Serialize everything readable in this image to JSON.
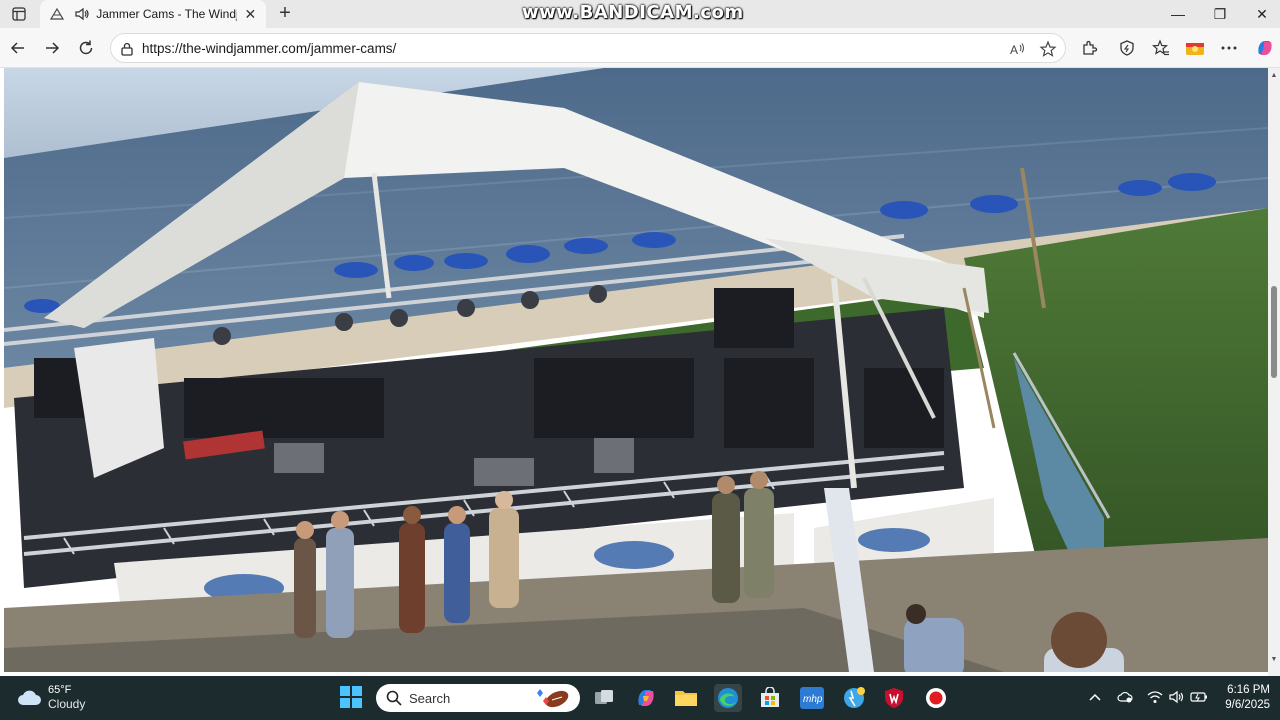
{
  "browser": {
    "tab": {
      "title": "Jammer Cams - The Windjammer",
      "close_glyph": "✕"
    },
    "new_tab_glyph": "+",
    "watermark": "www.BANDICAM.com",
    "window_controls": {
      "minimize": "—",
      "maximize": "❐",
      "close": "✕"
    },
    "address": {
      "url": "https://the-windjammer.com/jammer-cams/"
    }
  },
  "page": {
    "camera_feed": "jammer-cam-stage-view"
  },
  "taskbar": {
    "weather": {
      "temp": "65°F",
      "condition": "Cloudy"
    },
    "search": {
      "placeholder": "Search"
    },
    "clock": {
      "time": "6:16 PM",
      "date": "9/6/2025"
    }
  },
  "colors": {
    "taskbar": "#1c2b2e",
    "accent": "#0067c0"
  }
}
